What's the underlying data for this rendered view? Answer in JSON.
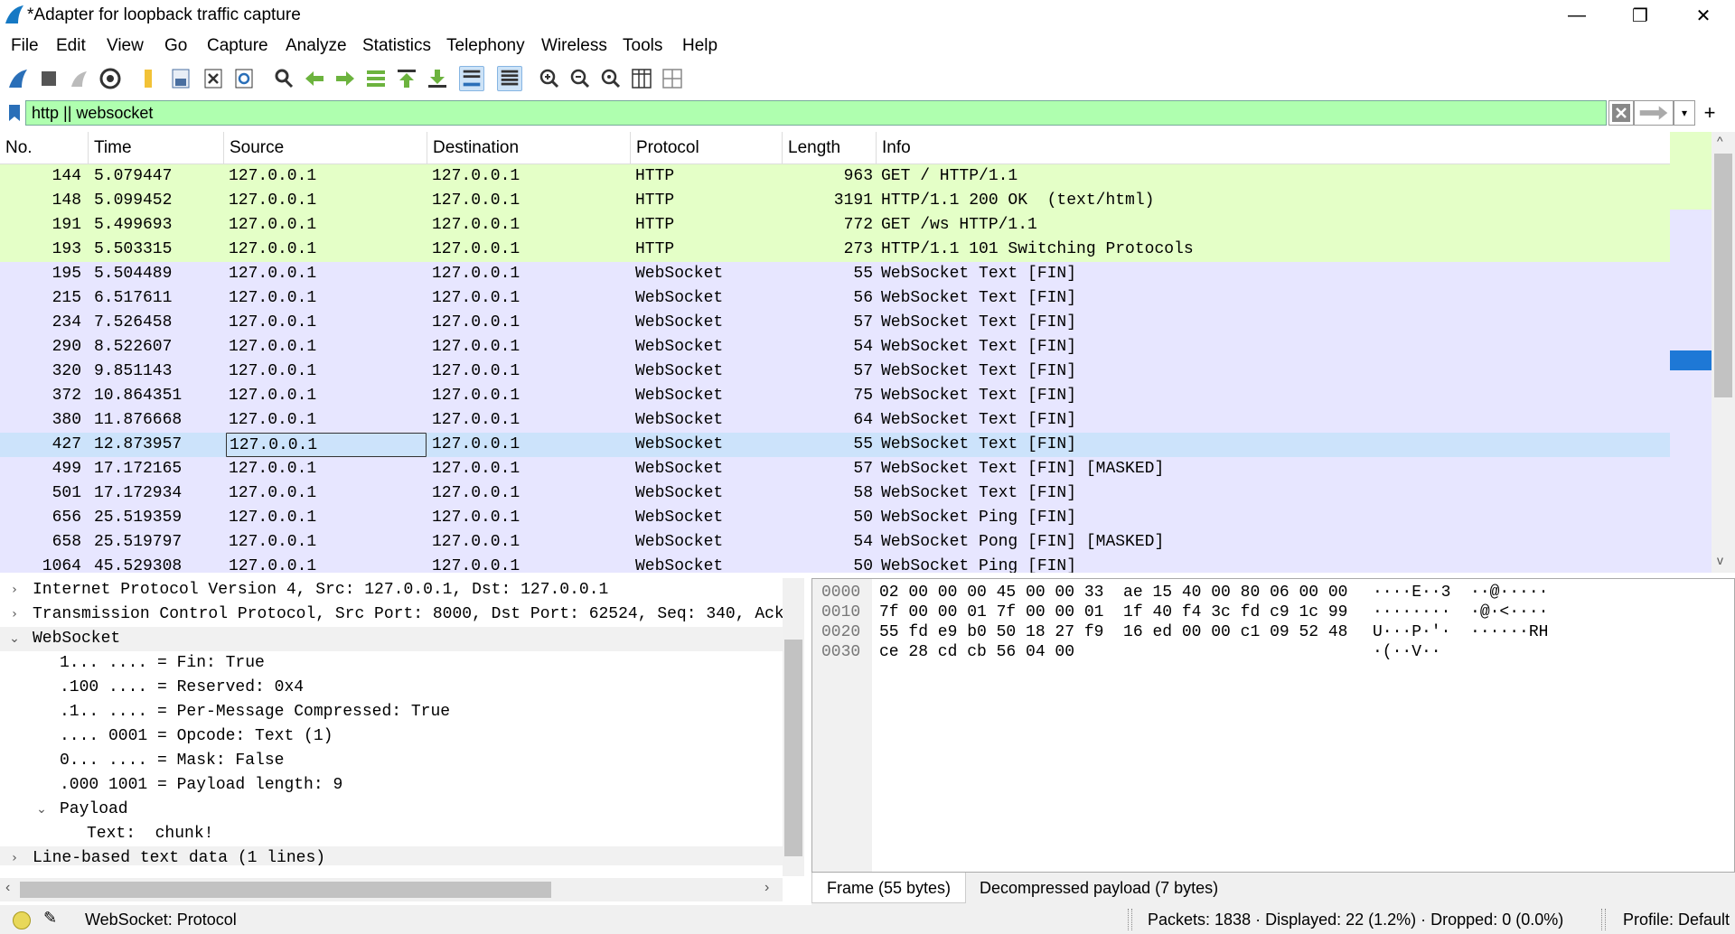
{
  "window": {
    "title": "*Adapter for loopback traffic capture",
    "minimize": "—",
    "restore": "❐",
    "close": "✕"
  },
  "menu": [
    "File",
    "Edit",
    "View",
    "Go",
    "Capture",
    "Analyze",
    "Statistics",
    "Telephony",
    "Wireless",
    "Tools",
    "Help"
  ],
  "toolbar_icons": [
    "shark-fin-start-icon",
    "stop-icon",
    "restart-icon",
    "capture-options-icon",
    "open-file-icon",
    "save-file-icon",
    "close-file-icon",
    "reload-file-icon",
    "find-packet-icon",
    "go-back-icon",
    "go-forward-icon",
    "go-to-packet-icon",
    "go-first-icon",
    "go-last-icon",
    "auto-scroll-icon",
    "colorize-icon",
    "zoom-in-icon",
    "zoom-out-icon",
    "normal-size-icon",
    "resize-columns-icon",
    "expand-icon"
  ],
  "filter": {
    "value": "http || websocket",
    "apply_label": "→",
    "dropdown": "▾",
    "add": "+"
  },
  "columns": [
    "No.",
    "Time",
    "Source",
    "Destination",
    "Protocol",
    "Length",
    "Info"
  ],
  "packets": [
    {
      "no": "144",
      "time": "5.079447",
      "src": "127.0.0.1",
      "dst": "127.0.0.1",
      "proto": "HTTP",
      "len": "963",
      "info": "GET / HTTP/1.1",
      "kind": "http"
    },
    {
      "no": "148",
      "time": "5.099452",
      "src": "127.0.0.1",
      "dst": "127.0.0.1",
      "proto": "HTTP",
      "len": "3191",
      "info": "HTTP/1.1 200 OK  (text/html)",
      "kind": "http"
    },
    {
      "no": "191",
      "time": "5.499693",
      "src": "127.0.0.1",
      "dst": "127.0.0.1",
      "proto": "HTTP",
      "len": "772",
      "info": "GET /ws HTTP/1.1",
      "kind": "http"
    },
    {
      "no": "193",
      "time": "5.503315",
      "src": "127.0.0.1",
      "dst": "127.0.0.1",
      "proto": "HTTP",
      "len": "273",
      "info": "HTTP/1.1 101 Switching Protocols",
      "kind": "http"
    },
    {
      "no": "195",
      "time": "5.504489",
      "src": "127.0.0.1",
      "dst": "127.0.0.1",
      "proto": "WebSocket",
      "len": "55",
      "info": "WebSocket Text [FIN]",
      "kind": "ws"
    },
    {
      "no": "215",
      "time": "6.517611",
      "src": "127.0.0.1",
      "dst": "127.0.0.1",
      "proto": "WebSocket",
      "len": "56",
      "info": "WebSocket Text [FIN]",
      "kind": "ws"
    },
    {
      "no": "234",
      "time": "7.526458",
      "src": "127.0.0.1",
      "dst": "127.0.0.1",
      "proto": "WebSocket",
      "len": "57",
      "info": "WebSocket Text [FIN]",
      "kind": "ws"
    },
    {
      "no": "290",
      "time": "8.522607",
      "src": "127.0.0.1",
      "dst": "127.0.0.1",
      "proto": "WebSocket",
      "len": "54",
      "info": "WebSocket Text [FIN]",
      "kind": "ws"
    },
    {
      "no": "320",
      "time": "9.851143",
      "src": "127.0.0.1",
      "dst": "127.0.0.1",
      "proto": "WebSocket",
      "len": "57",
      "info": "WebSocket Text [FIN]",
      "kind": "ws"
    },
    {
      "no": "372",
      "time": "10.864351",
      "src": "127.0.0.1",
      "dst": "127.0.0.1",
      "proto": "WebSocket",
      "len": "75",
      "info": "WebSocket Text [FIN]",
      "kind": "ws"
    },
    {
      "no": "380",
      "time": "11.876668",
      "src": "127.0.0.1",
      "dst": "127.0.0.1",
      "proto": "WebSocket",
      "len": "64",
      "info": "WebSocket Text [FIN]",
      "kind": "ws"
    },
    {
      "no": "427",
      "time": "12.873957",
      "src": "127.0.0.1",
      "dst": "127.0.0.1",
      "proto": "WebSocket",
      "len": "55",
      "info": "WebSocket Text [FIN]",
      "kind": "sel"
    },
    {
      "no": "499",
      "time": "17.172165",
      "src": "127.0.0.1",
      "dst": "127.0.0.1",
      "proto": "WebSocket",
      "len": "57",
      "info": "WebSocket Text [FIN] [MASKED]",
      "kind": "ws"
    },
    {
      "no": "501",
      "time": "17.172934",
      "src": "127.0.0.1",
      "dst": "127.0.0.1",
      "proto": "WebSocket",
      "len": "58",
      "info": "WebSocket Text [FIN]",
      "kind": "ws"
    },
    {
      "no": "656",
      "time": "25.519359",
      "src": "127.0.0.1",
      "dst": "127.0.0.1",
      "proto": "WebSocket",
      "len": "50",
      "info": "WebSocket Ping [FIN]",
      "kind": "ws"
    },
    {
      "no": "658",
      "time": "25.519797",
      "src": "127.0.0.1",
      "dst": "127.0.0.1",
      "proto": "WebSocket",
      "len": "54",
      "info": "WebSocket Pong [FIN] [MASKED]",
      "kind": "ws"
    },
    {
      "no": "1064",
      "time": "45.529308",
      "src": "127.0.0.1",
      "dst": "127.0.0.1",
      "proto": "WebSocket",
      "len": "50",
      "info": "WebSocket Ping [FIN]",
      "kind": "ws"
    }
  ],
  "details": [
    {
      "text": "Internet Protocol Version 4, Src: 127.0.0.1, Dst: 127.0.0.1",
      "indent": 0,
      "expander": ">",
      "gray": false
    },
    {
      "text": "Transmission Control Protocol, Src Port: 8000, Dst Port: 62524, Seq: 340, Ack",
      "indent": 0,
      "expander": ">",
      "gray": false
    },
    {
      "text": "WebSocket",
      "indent": 0,
      "expander": "v",
      "gray": true
    },
    {
      "text": "1... .... = Fin: True",
      "indent": 2,
      "expander": "",
      "gray": false
    },
    {
      "text": ".100 .... = Reserved: 0x4",
      "indent": 2,
      "expander": "",
      "gray": false
    },
    {
      "text": ".1.. .... = Per-Message Compressed: True",
      "indent": 2,
      "expander": "",
      "gray": false
    },
    {
      "text": ".... 0001 = Opcode: Text (1)",
      "indent": 2,
      "expander": "",
      "gray": false
    },
    {
      "text": "0... .... = Mask: False",
      "indent": 2,
      "expander": "",
      "gray": false
    },
    {
      "text": ".000 1001 = Payload length: 9",
      "indent": 2,
      "expander": "",
      "gray": false
    },
    {
      "text": "Payload",
      "indent": 1,
      "expander": "v",
      "gray": false
    },
    {
      "text": "Text:  chunk!",
      "indent": 3,
      "expander": "",
      "gray": false
    },
    {
      "text": "Line-based text data (1 lines)",
      "indent": 0,
      "expander": ">",
      "gray": true
    }
  ],
  "hex": [
    {
      "offset": "0000",
      "bytes": "02 00 00 00 45 00 00 33  ae 15 40 00 80 06 00 00",
      "ascii": "····E··3  ··@·····"
    },
    {
      "offset": "0010",
      "bytes": "7f 00 00 01 7f 00 00 01  1f 40 f4 3c fd c9 1c 99",
      "ascii": "········  ·@·<····"
    },
    {
      "offset": "0020",
      "bytes": "55 fd e9 b0 50 18 27 f9  16 ed 00 00 c1 09 52 48",
      "ascii": "U···P·'·  ······RH"
    },
    {
      "offset": "0030",
      "bytes": "ce 28 cd cb 56 04 00",
      "ascii": "·(··V··"
    }
  ],
  "hex_tabs": [
    "Frame (55 bytes)",
    "Decompressed payload (7 bytes)"
  ],
  "status": {
    "left": "WebSocket: Protocol",
    "packets": "Packets: 1838 · Displayed: 22 (1.2%) · Dropped: 0 (0.0%)",
    "profile": "Profile: Default"
  },
  "colors": {
    "http_row": "#e4ffc7",
    "ws_row": "#e7e6ff",
    "selected_row": "#cce3fb",
    "filter_ok": "#afffaf"
  }
}
